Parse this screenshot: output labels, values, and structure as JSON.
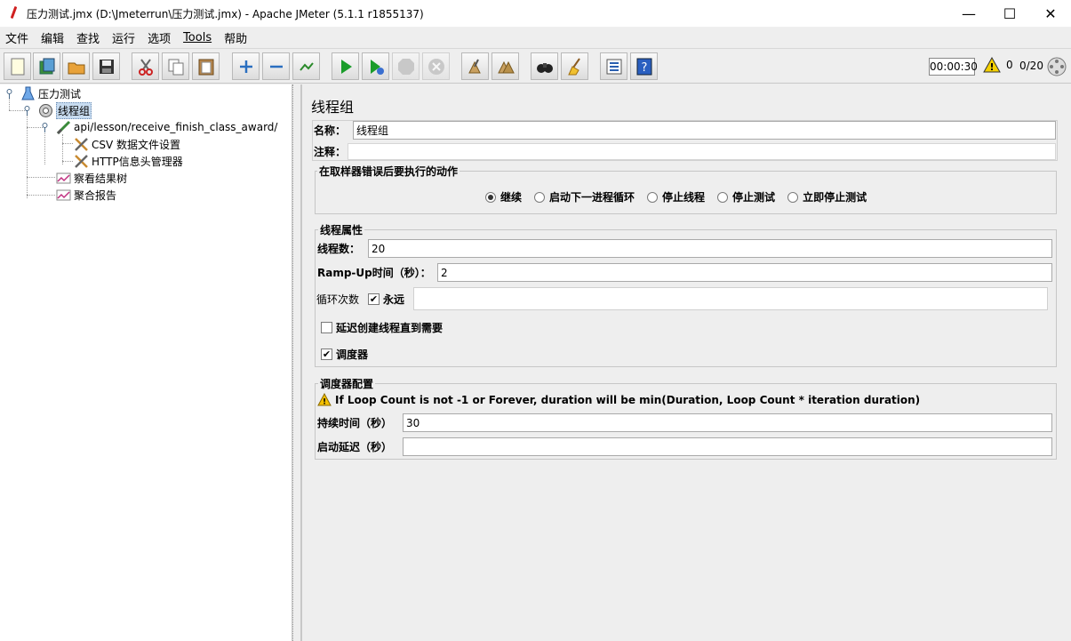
{
  "window": {
    "title": "压力测试.jmx (D:\\Jmeterrun\\压力测试.jmx) - Apache JMeter (5.1.1 r1855137)",
    "minimize": "—",
    "maximize": "☐",
    "close": "✕"
  },
  "menu": [
    {
      "label": "文件"
    },
    {
      "label": "编辑"
    },
    {
      "label": "查找"
    },
    {
      "label": "运行"
    },
    {
      "label": "选项"
    },
    {
      "label": "Tools"
    },
    {
      "label": "帮助"
    }
  ],
  "toolbar": {
    "icons": [
      "new-icon",
      "templates-icon",
      "open-icon",
      "save-icon",
      "cut-icon",
      "copy-icon",
      "paste-icon",
      "expand-icon",
      "collapse-icon",
      "toggle-icon",
      "start-icon",
      "start-no-pause-icon",
      "stop-icon",
      "shutdown-icon",
      "clear-icon",
      "clear-all-icon",
      "search-icon",
      "reset-search-icon",
      "function-helper-icon",
      "help-icon"
    ],
    "timer": "00:00:30",
    "warning_count": "0",
    "thread_count": "0/20"
  },
  "tree": [
    {
      "label": "压力测试",
      "icon": "test-plan-icon"
    },
    {
      "label": "线程组",
      "icon": "thread-group-icon",
      "selected": true
    },
    {
      "label": "api/lesson/receive_finish_class_award/",
      "icon": "sampler-icon"
    },
    {
      "label": "CSV 数据文件设置",
      "icon": "config-element-icon"
    },
    {
      "label": "HTTP信息头管理器",
      "icon": "config-element-icon"
    },
    {
      "label": "察看结果树",
      "icon": "listener-icon"
    },
    {
      "label": "聚合报告",
      "icon": "listener-icon"
    }
  ],
  "panel": {
    "title": "线程组",
    "name_label": "名称：",
    "name_value": "线程组",
    "comment_label": "注释：",
    "comment_value": "",
    "error_action": {
      "title": "在取样器错误后要执行的动作",
      "options": [
        {
          "label": "继续",
          "selected": true
        },
        {
          "label": "启动下一进程循环",
          "selected": false
        },
        {
          "label": "停止线程",
          "selected": false
        },
        {
          "label": "停止测试",
          "selected": false
        },
        {
          "label": "立即停止测试",
          "selected": false
        }
      ]
    },
    "thread_props": {
      "title": "线程属性",
      "threads_label": "线程数：",
      "threads_value": "20",
      "rampup_label": "Ramp-Up时间（秒）：",
      "rampup_value": "2",
      "loop_label": "循环次数",
      "forever_label": "永远",
      "forever_checked": true,
      "loop_value": "",
      "delay_label": "延迟创建线程直到需要",
      "delay_checked": false,
      "scheduler_label": "调度器",
      "scheduler_checked": true
    },
    "scheduler": {
      "title": "调度器配置",
      "warning": "If Loop Count is not -1 or Forever, duration will be min(Duration, Loop Count * iteration duration)",
      "duration_label": "持续时间（秒）",
      "duration_value": "30",
      "delay_label": "启动延迟（秒）",
      "delay_value": ""
    }
  },
  "colors": {
    "selection": "#c8dcf0",
    "background": "#eeeeee",
    "start_green": "#1a9c2a"
  }
}
